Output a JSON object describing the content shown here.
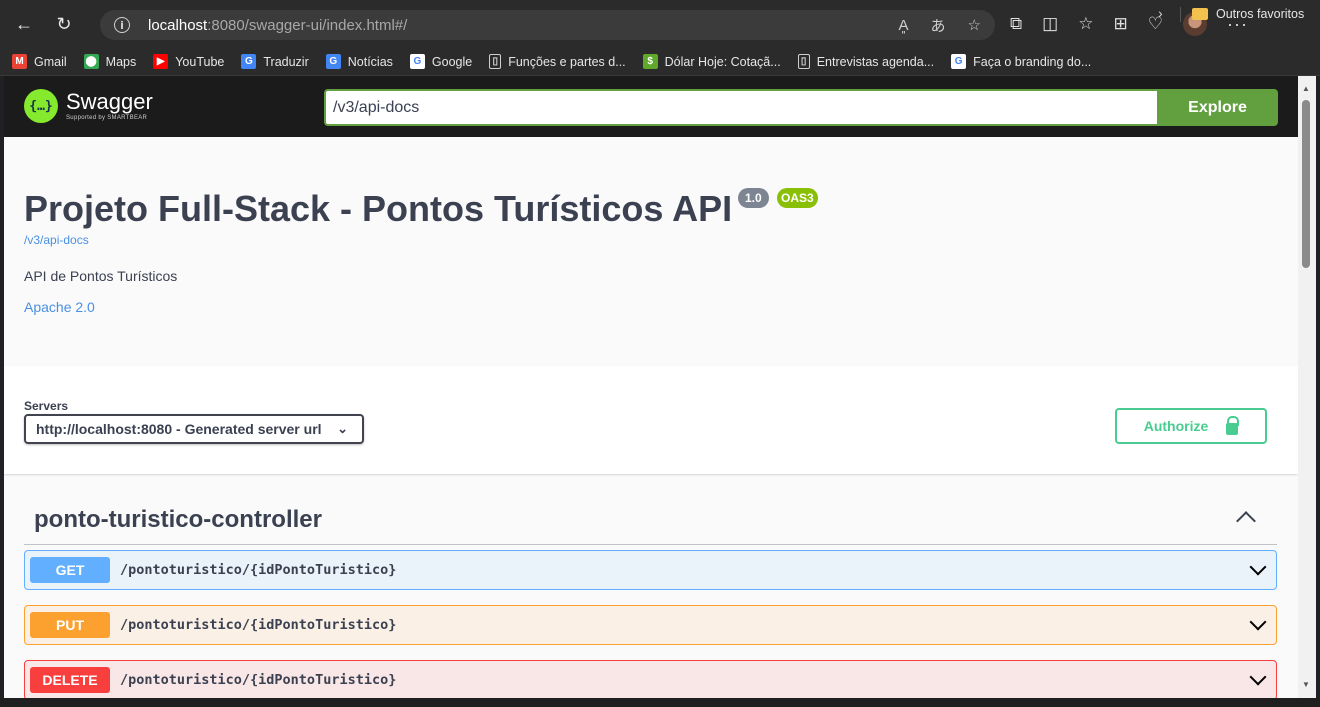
{
  "browser": {
    "url_host": "localhost",
    "url_rest": ":8080/swagger-ui/index.html#/",
    "bookmarks": [
      {
        "label": "Gmail",
        "icon": "gmail-icon",
        "color": "#ea4335",
        "glyph": "M"
      },
      {
        "label": "Maps",
        "icon": "maps-icon",
        "color": "#34a853",
        "glyph": "⬤"
      },
      {
        "label": "YouTube",
        "icon": "youtube-icon",
        "color": "#ff0000",
        "glyph": "▶"
      },
      {
        "label": "Traduzir",
        "icon": "translate-icon",
        "color": "#4285f4",
        "glyph": "G"
      },
      {
        "label": "Notícias",
        "icon": "news-icon",
        "color": "#4285f4",
        "glyph": "G"
      },
      {
        "label": "Google",
        "icon": "google-icon",
        "color": "#ffffff",
        "glyph": "G"
      },
      {
        "label": "Funções e partes d...",
        "icon": "page-icon",
        "color": "#2b2b2b",
        "glyph": "▯"
      },
      {
        "label": "Dólar Hoje: Cotaçã...",
        "icon": "dollar-icon",
        "color": "#5fa82a",
        "glyph": "$"
      },
      {
        "label": "Entrevistas agenda...",
        "icon": "page-icon",
        "color": "#2b2b2b",
        "glyph": "▯"
      },
      {
        "label": "Faça o branding do...",
        "icon": "google-icon",
        "color": "#ffffff",
        "glyph": "G"
      }
    ],
    "other_favorites": "Outros favoritos"
  },
  "topbar": {
    "logo_text": "Swagger",
    "logo_subtext": "Supported by SMARTBEAR",
    "url_value": "/v3/api-docs",
    "explore_label": "Explore"
  },
  "info": {
    "title": "Projeto Full-Stack - Pontos Turísticos API",
    "version": "1.0",
    "oas": "OAS3",
    "docs_link": "/v3/api-docs",
    "description": "API de Pontos Turísticos",
    "license": "Apache 2.0"
  },
  "servers": {
    "label": "Servers",
    "selected": "http://localhost:8080 - Generated server url",
    "authorize_label": "Authorize"
  },
  "controller": {
    "name": "ponto-turistico-controller",
    "operations": [
      {
        "method": "GET",
        "path": "/pontoturistico/{idPontoTuristico}"
      },
      {
        "method": "PUT",
        "path": "/pontoturistico/{idPontoTuristico}"
      },
      {
        "method": "DELETE",
        "path": "/pontoturistico/{idPontoTuristico}"
      }
    ]
  },
  "colors": {
    "get": "#61affe",
    "put": "#fca130",
    "delete": "#f93e3e",
    "swagger_green": "#62a03f",
    "authorize": "#49cc90"
  }
}
